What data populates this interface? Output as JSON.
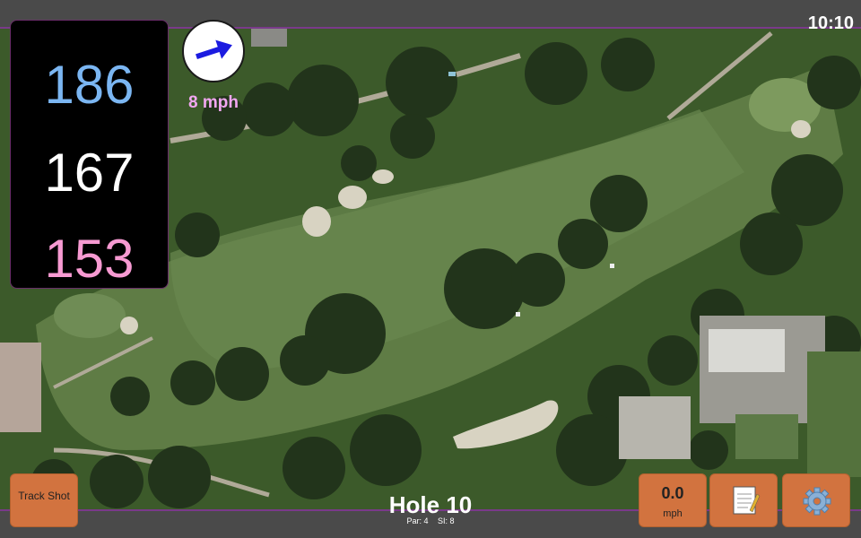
{
  "status": {
    "time": "10:10"
  },
  "yardages": {
    "back": "186",
    "middle": "167",
    "front": "153"
  },
  "wind": {
    "speed": "8 mph",
    "direction_icon": "arrow-right-icon"
  },
  "hole": {
    "title": "Hole 10",
    "par": "Par: 4",
    "si": "SI: 8"
  },
  "buttons": {
    "track_shot": "Track Shot",
    "speed_value": "0.0",
    "speed_unit": "mph",
    "notes_icon": "notepad-icon",
    "settings_icon": "gear-icon"
  },
  "colors": {
    "back": "#7bb6f2",
    "middle": "#ffffff",
    "front": "#f79ad2",
    "button": "#d2733f",
    "wind_text": "#f2a7f2"
  }
}
